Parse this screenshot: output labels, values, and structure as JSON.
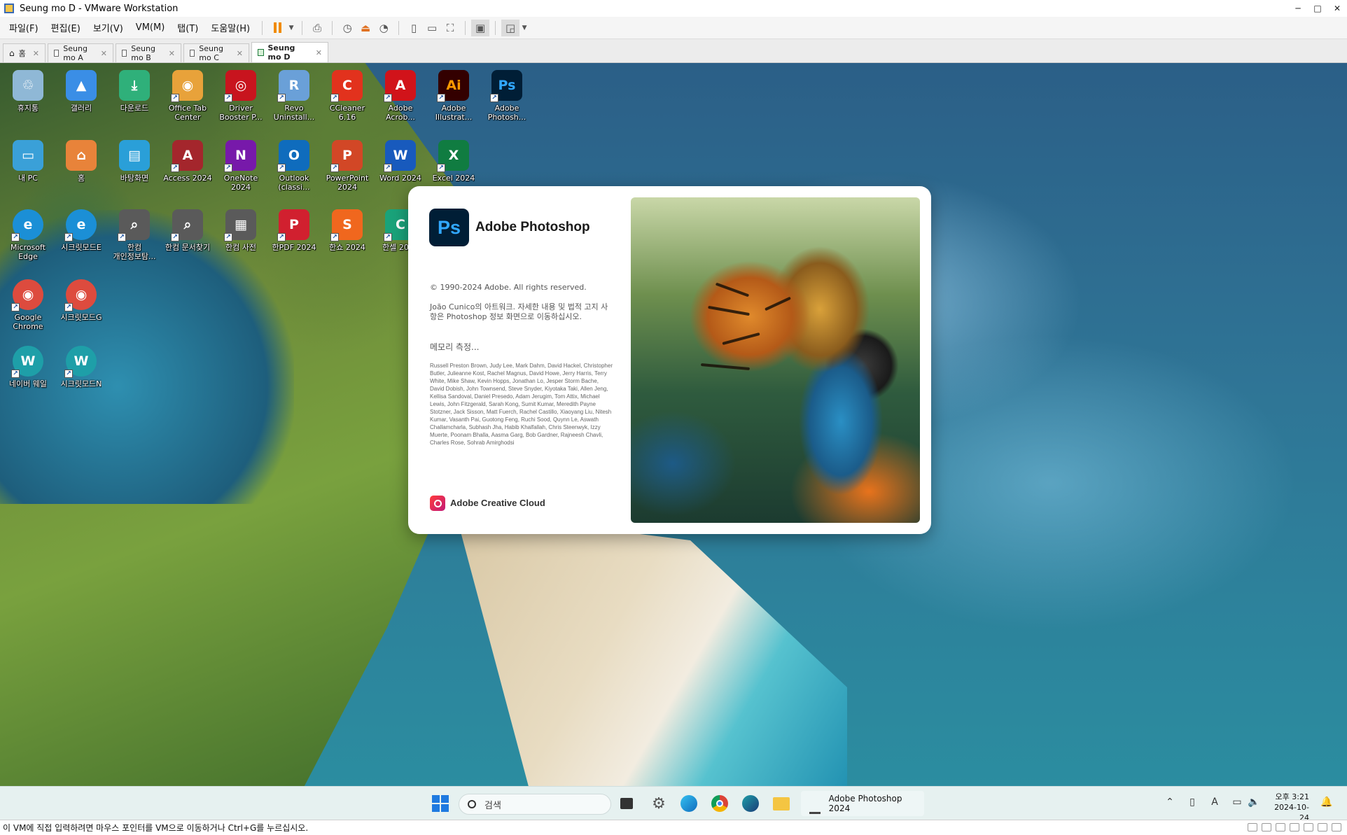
{
  "window": {
    "title": "Seung mo D - VMware Workstation",
    "minimize": "─",
    "maximize": "□",
    "close": "✕"
  },
  "menu": {
    "items": [
      "파일(F)",
      "편집(E)",
      "보기(V)",
      "VM(M)",
      "탭(T)",
      "도움말(H)"
    ]
  },
  "tabs": [
    {
      "label": "홈",
      "close": "✕"
    },
    {
      "label": "Seung mo A",
      "close": "✕"
    },
    {
      "label": "Seung mo B",
      "close": "✕"
    },
    {
      "label": "Seung mo C",
      "close": "✕"
    },
    {
      "label": "Seung mo D",
      "close": "✕"
    }
  ],
  "desktop_icons": [
    {
      "label": "휴지통",
      "glyph": "♲",
      "color": "#8fb8d6"
    },
    {
      "label": "갤러리",
      "glyph": "▲",
      "color": "#3a8ee6"
    },
    {
      "label": "다운로드",
      "glyph": "⤓",
      "color": "#2fb07a"
    },
    {
      "label": "Office Tab Center",
      "glyph": "◉",
      "color": "#e8a23a"
    },
    {
      "label": "Driver Booster P...",
      "glyph": "◎",
      "color": "#c8141e"
    },
    {
      "label": "Revo Uninstall...",
      "glyph": "R",
      "color": "#6aa0d8"
    },
    {
      "label": "CCleaner 6.16",
      "glyph": "C",
      "color": "#e2321d"
    },
    {
      "label": "Adobe Acrob...",
      "glyph": "A",
      "color": "#d1131a"
    },
    {
      "label": "Adobe Illustrat...",
      "glyph": "Ai",
      "color": "#330000",
      "fg": "#ff9a00"
    },
    {
      "label": "Adobe Photosh...",
      "glyph": "Ps",
      "color": "#001e36",
      "fg": "#31a8ff"
    },
    {
      "label": "내 PC",
      "glyph": "▭",
      "color": "#3aa0d8"
    },
    {
      "label": "홈",
      "glyph": "⌂",
      "color": "#e8833a"
    },
    {
      "label": "바탕화면",
      "glyph": "▤",
      "color": "#2a9fd8"
    },
    {
      "label": "Access 2024",
      "glyph": "A",
      "color": "#a4262c"
    },
    {
      "label": "OneNote 2024",
      "glyph": "N",
      "color": "#7719aa"
    },
    {
      "label": "Outlook (classi...",
      "glyph": "O",
      "color": "#0f6cbd"
    },
    {
      "label": "PowerPoint 2024",
      "glyph": "P",
      "color": "#d24726"
    },
    {
      "label": "Word 2024",
      "glyph": "W",
      "color": "#185abd"
    },
    {
      "label": "Excel 2024",
      "glyph": "X",
      "color": "#107c41"
    },
    {
      "label": "Microsoft Edge",
      "glyph": "e",
      "color": "#1b8fd6",
      "round": true
    },
    {
      "label": "시크릿모드E",
      "glyph": "e",
      "color": "#1b8fd6",
      "round": true
    },
    {
      "label": "한컴 개인정보탐...",
      "glyph": "⌕",
      "color": "#5a5a5a"
    },
    {
      "label": "한컴 문서찾기",
      "glyph": "⌕",
      "color": "#5a5a5a"
    },
    {
      "label": "한컴 사전",
      "glyph": "▦",
      "color": "#5a5a5a"
    },
    {
      "label": "한PDF 2024",
      "glyph": "P",
      "color": "#d1202f"
    },
    {
      "label": "한쇼 2024",
      "glyph": "S",
      "color": "#f0671e"
    },
    {
      "label": "한셀 2024",
      "glyph": "C",
      "color": "#1aa37a"
    },
    {
      "label": "Google Chrome",
      "glyph": "◉",
      "color": "#dd4b3e",
      "round": true
    },
    {
      "label": "시크릿모드G",
      "glyph": "◉",
      "color": "#dd4b3e",
      "round": true
    },
    {
      "label": "네이버 웨일",
      "glyph": "W",
      "color": "#1e9fa8",
      "round": true
    },
    {
      "label": "시크릿모드N",
      "glyph": "W",
      "color": "#1e9fa8",
      "round": true
    }
  ],
  "splash": {
    "logo": "Ps",
    "product": "Adobe Photoshop",
    "copyright": "© 1990-2024 Adobe. All rights reserved.",
    "artwork_note": "João Cunico의 아트워크. 자세한 내용 및 법적 고지 사항은 Photoshop 정보 화면으로 이동하십시오.",
    "memory_status": "메모리 측정...",
    "credits": "Russell Preston Brown, Judy Lee, Mark Dahm, David Hackel, Christopher Butler, Julieanne Kost, Rachel Magnus, David Howe, Jerry Harris, Terry White, Mike Shaw, Kevin Hopps, Jonathan Lo, Jesper Storm Bache, David Dobish, John Townsend, Steve Snyder, Kiyotaka Taki, Allen Jeng, Kellisa Sandoval, Daniel Presedo, Adam Jerugim, Tom Attix, Michael Lewis, John Fitzgerald, Sarah Kong, Sumit Kumar, Meredith Payne Stotzner, Jack Sisson, Matt Fuerch, Rachel Castillo, Xiaoyang Liu, Nitesh Kumar, Vasanth Pai, Guotong Feng, Ruchi Sood, Quynn Le, Aswath Challamcharla, Subhash Jha, Habib Khalfallah, Chris Steenwyk, Izzy Muerte, Poonam Bhalla, Aasma Garg, Bob Gardner, Rajneesh Chavli, Charles Rose, Sohrab Amirghodsi",
    "cloud_label": "Adobe Creative Cloud"
  },
  "taskbar": {
    "search_placeholder": "검색",
    "running_app": "Adobe Photoshop 2024",
    "time": "오후 3:21",
    "date": "2024-10-24"
  },
  "status_message": "이 VM에 직접 입력하려면 마우스 포인터를 VM으로 이동하거나 Ctrl+G를 누르십시오."
}
